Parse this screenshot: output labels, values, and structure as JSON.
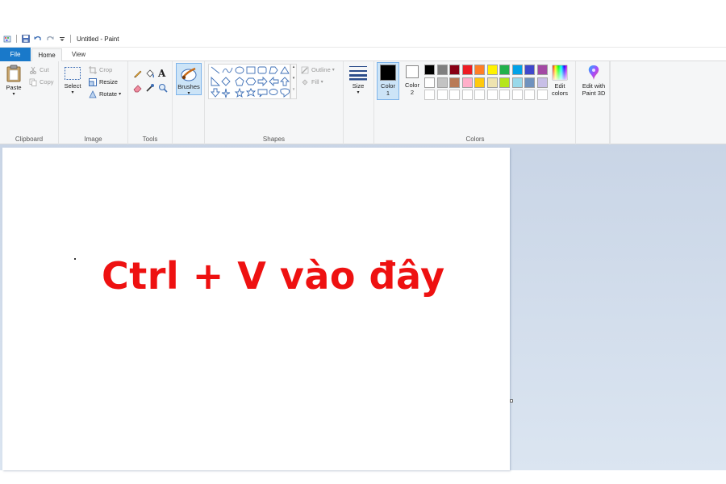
{
  "window": {
    "title": "Untitled - Paint"
  },
  "tabs": [
    {
      "label": "File"
    },
    {
      "label": "Home"
    },
    {
      "label": "View"
    }
  ],
  "clipboard": {
    "paste": "Paste",
    "cut": "Cut",
    "copy": "Copy",
    "group": "Clipboard"
  },
  "image": {
    "select": "Select",
    "crop": "Crop",
    "resize": "Resize",
    "rotate": "Rotate",
    "group": "Image"
  },
  "tools": {
    "group": "Tools",
    "text_glyph": "A"
  },
  "brushes": {
    "label": "Brushes"
  },
  "shapes": {
    "outline": "Outline",
    "fill": "Fill",
    "group": "Shapes"
  },
  "size": {
    "label": "Size"
  },
  "colors": {
    "color1_label": "Color",
    "color1_num": "1",
    "color2_label": "Color",
    "color2_num": "2",
    "group": "Colors",
    "edit_colors_1": "Edit",
    "edit_colors_2": "colors",
    "color1": "#000000",
    "color2": "#ffffff",
    "palette_row1": [
      "#000000",
      "#7f7f7f",
      "#880015",
      "#ed1c24",
      "#ff7f27",
      "#fff200",
      "#22b14c",
      "#00a2e8",
      "#3f48cc",
      "#a349a4"
    ],
    "palette_row2": [
      "#ffffff",
      "#c3c3c3",
      "#b97a57",
      "#ffaec9",
      "#ffc90e",
      "#efe4b0",
      "#b5e61d",
      "#99d9ea",
      "#7092be",
      "#c8bfe7"
    ]
  },
  "paint3d": {
    "line1": "Edit with",
    "line2": "Paint 3D"
  },
  "canvas": {
    "text": "Ctrl + V vào đây"
  }
}
